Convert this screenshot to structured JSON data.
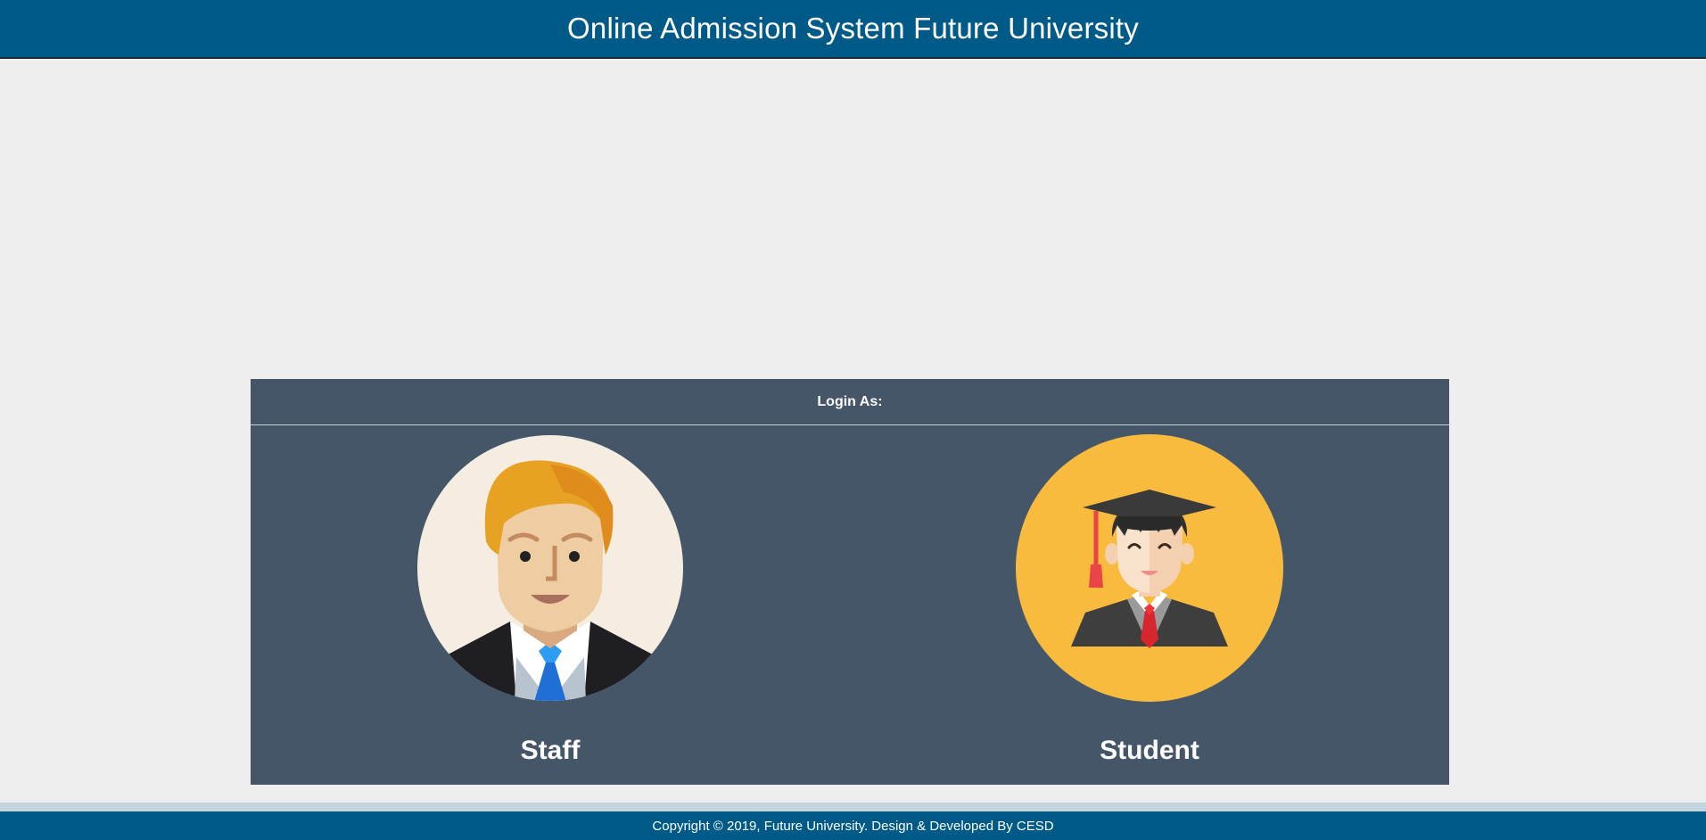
{
  "header": {
    "title": "Online Admission System Future University"
  },
  "login": {
    "heading": "Login As:",
    "options": [
      {
        "label": "Staff",
        "icon": "staff-avatar-icon"
      },
      {
        "label": "Student",
        "icon": "student-graduate-avatar-icon"
      }
    ]
  },
  "footer": {
    "copyright": "Copyright © 2019, Future University. Design & Developed By CESD"
  },
  "colors": {
    "header_bg": "#005a87",
    "panel_bg": "#455668",
    "page_bg": "#eeeeee",
    "student_circle": "#f9bb3e",
    "staff_circle": "#f5ede2"
  }
}
